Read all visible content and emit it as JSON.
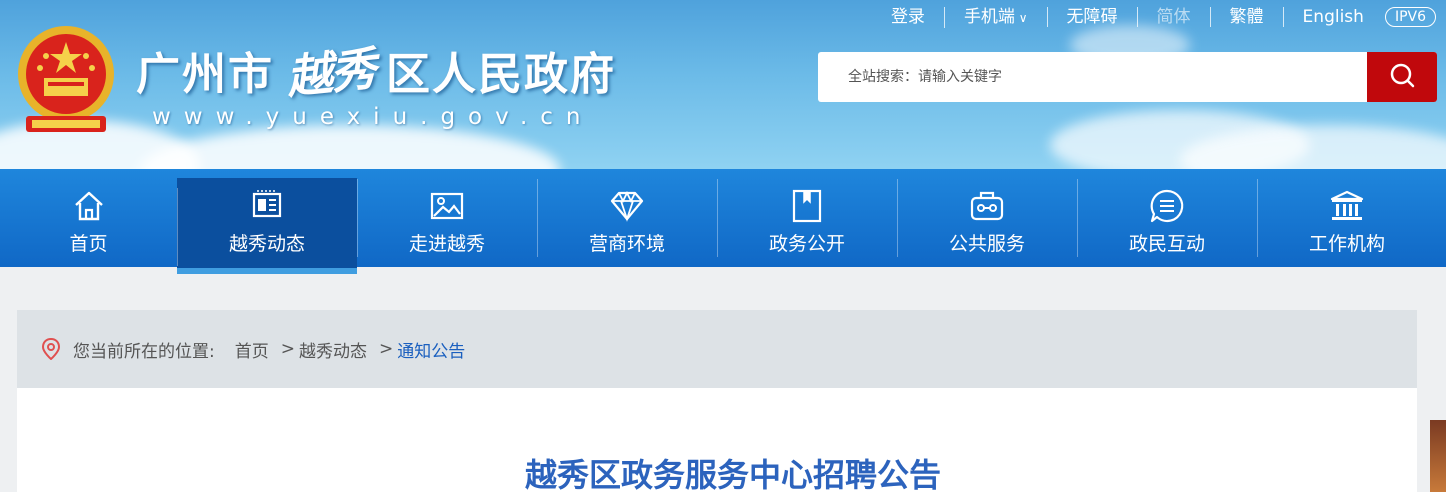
{
  "banner": {
    "site_name_prefix": "广州市",
    "site_name_calligraphy": "越秀",
    "site_name_suffix": "区人民政府",
    "site_url": "www.yuexiu.gov.cn",
    "emblem_icon": "national-emblem-icon"
  },
  "toplinks": {
    "login": "登录",
    "mobile": "手机端",
    "accessibility": "无障碍",
    "simplified": "简体",
    "traditional": "繁體",
    "english": "English",
    "ipv6": "IPV6"
  },
  "search": {
    "placeholder": "全站搜索：请输入关键字",
    "button_icon": "search-icon",
    "button_color": "#c0080c"
  },
  "nav": {
    "items": [
      {
        "label": "首页",
        "icon": "home-icon",
        "active": false
      },
      {
        "label": "越秀动态",
        "icon": "news-icon",
        "active": true
      },
      {
        "label": "走进越秀",
        "icon": "picture-icon",
        "active": false
      },
      {
        "label": "营商环境",
        "icon": "diamond-icon",
        "active": false
      },
      {
        "label": "政务公开",
        "icon": "folder-icon",
        "active": false
      },
      {
        "label": "公共服务",
        "icon": "briefcase-icon",
        "active": false
      },
      {
        "label": "政民互动",
        "icon": "chat-icon",
        "active": false
      },
      {
        "label": "工作机构",
        "icon": "institution-icon",
        "active": false
      }
    ],
    "bg_color": "#1068c6",
    "active_color": "#0b4f9e"
  },
  "breadcrumb": {
    "prefix": "您当前所在的位置:",
    "items": [
      {
        "label": "首页"
      },
      {
        "label": "越秀动态"
      },
      {
        "label": "通知公告"
      }
    ],
    "separator": ">"
  },
  "article": {
    "title": "越秀区政务服务中心招聘公告",
    "title_color": "#2c63bd"
  }
}
